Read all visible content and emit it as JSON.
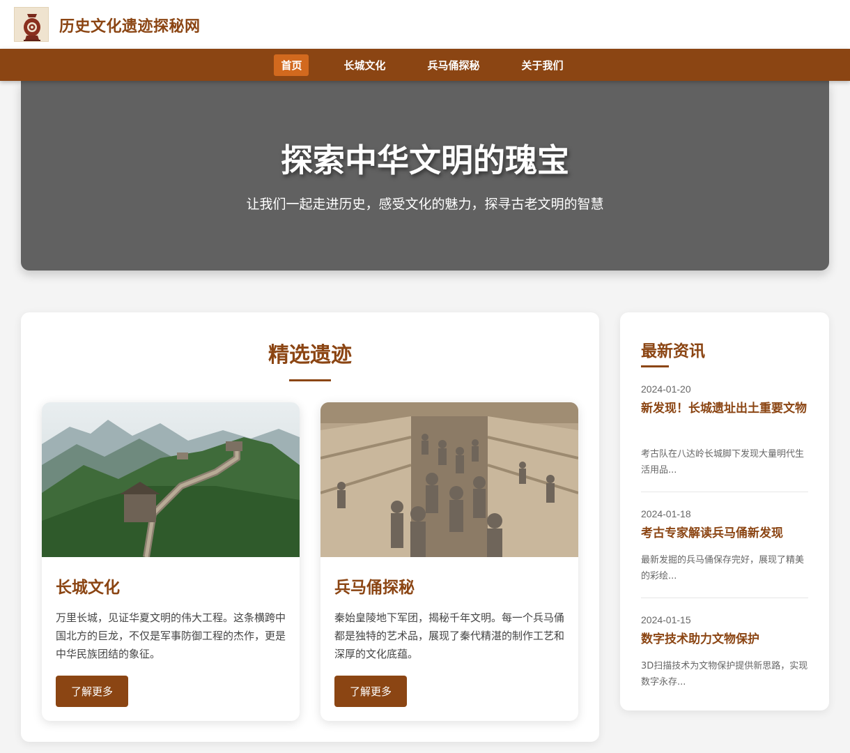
{
  "site": {
    "title": "历史文化遗迹探秘网"
  },
  "nav": {
    "items": [
      {
        "label": "首页",
        "active": true
      },
      {
        "label": "长城文化",
        "active": false
      },
      {
        "label": "兵马俑探秘",
        "active": false
      },
      {
        "label": "关于我们",
        "active": false
      }
    ]
  },
  "hero": {
    "title": "探索中华文明的瑰宝",
    "subtitle": "让我们一起走进历史，感受文化的魅力，探寻古老文明的智慧"
  },
  "featured": {
    "title": "精选遗迹",
    "cards": [
      {
        "title": "长城文化",
        "text": "万里长城，见证华夏文明的伟大工程。这条横跨中国北方的巨龙，不仅是军事防御工程的杰作，更是中华民族团结的象征。",
        "button": "了解更多"
      },
      {
        "title": "兵马俑探秘",
        "text": "秦始皇陵地下军团，揭秘千年文明。每一个兵马俑都是独特的艺术品，展现了秦代精湛的制作工艺和深厚的文化底蕴。",
        "button": "了解更多"
      }
    ]
  },
  "news": {
    "title": "最新资讯",
    "items": [
      {
        "date": "2024-01-20",
        "headline": "新发现！长城遗址出土重要文物",
        "summary": "考古队在八达岭长城脚下发现大量明代生活用品..."
      },
      {
        "date": "2024-01-18",
        "headline": "考古专家解读兵马俑新发现",
        "summary": "最新发掘的兵马俑保存完好，展现了精美的彩绘..."
      },
      {
        "date": "2024-01-15",
        "headline": "数字技术助力文物保护",
        "summary": "3D扫描技术为文物保护提供新思路，实现数字永存..."
      }
    ]
  },
  "colors": {
    "brand": "#8b4513",
    "active": "#d2691e",
    "hero_bg": "#616161"
  },
  "icons": {
    "logo": "bronze-vessel-logo-icon"
  }
}
